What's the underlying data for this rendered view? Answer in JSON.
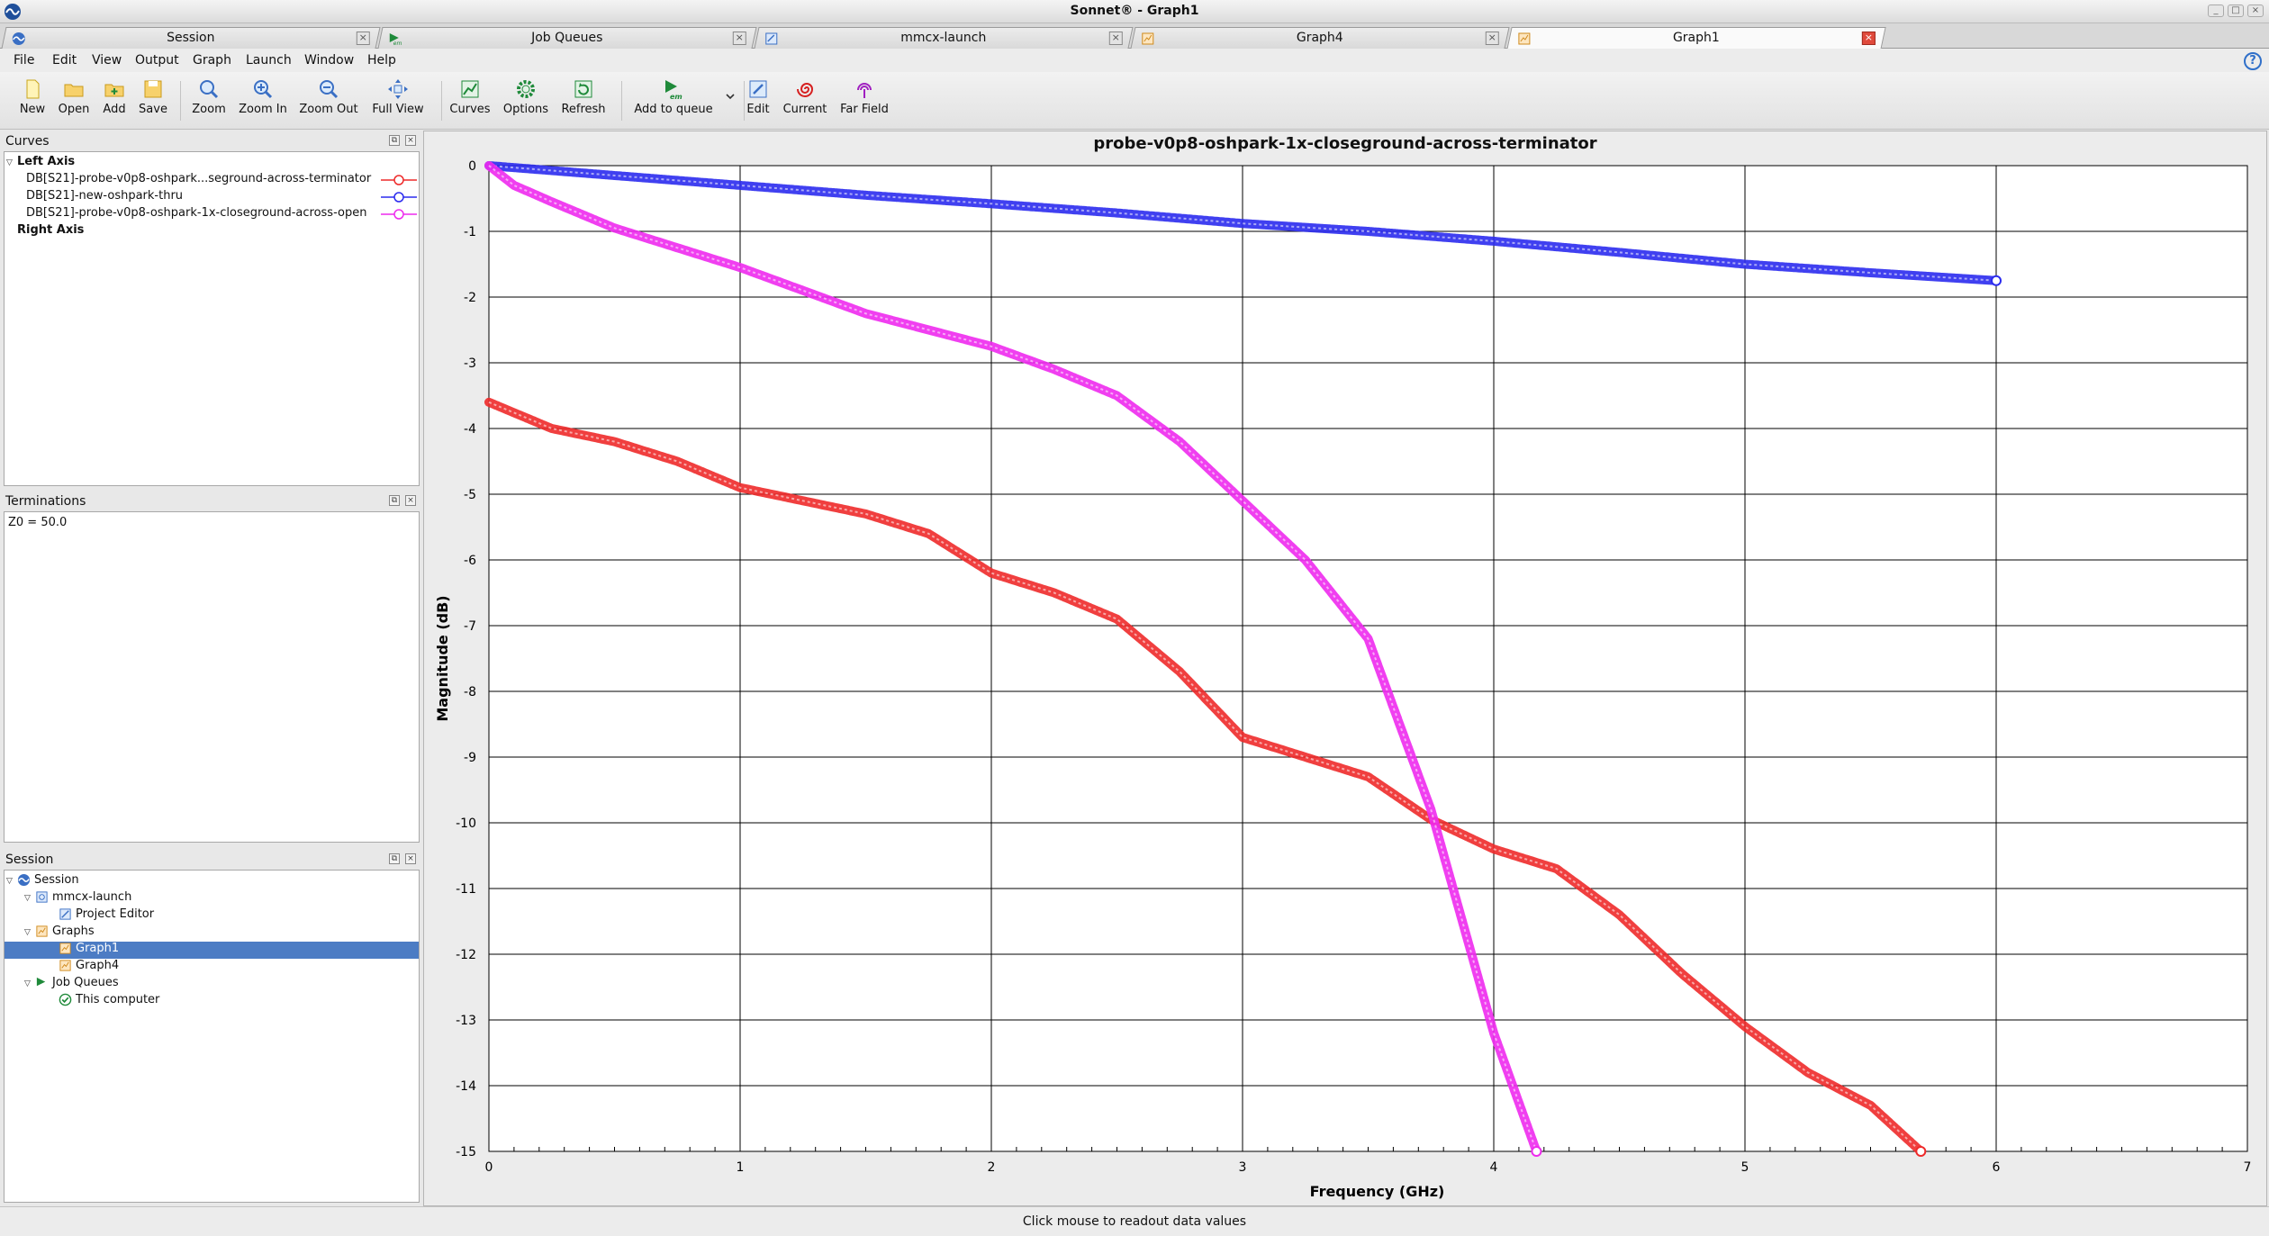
{
  "window": {
    "title": "Sonnet® - Graph1"
  },
  "tabs": [
    {
      "label": "Session",
      "icon": "session-icon",
      "active": false
    },
    {
      "label": "Job Queues",
      "icon": "job-queue-icon",
      "active": false
    },
    {
      "label": "mmcx-launch",
      "icon": "project-icon",
      "active": false
    },
    {
      "label": "Graph4",
      "icon": "graph-icon",
      "active": false
    },
    {
      "label": "Graph1",
      "icon": "graph-icon",
      "active": true
    }
  ],
  "menu": [
    "File",
    "Edit",
    "View",
    "Output",
    "Graph",
    "Launch",
    "Window",
    "Help"
  ],
  "toolbar": [
    {
      "label": "New",
      "icon": "new-file-icon"
    },
    {
      "label": "Open",
      "icon": "open-folder-icon"
    },
    {
      "label": "Add",
      "icon": "add-folder-icon"
    },
    {
      "label": "Save",
      "icon": "save-icon"
    },
    {
      "label": "Zoom",
      "icon": "zoom-icon"
    },
    {
      "label": "Zoom In",
      "icon": "zoom-in-icon"
    },
    {
      "label": "Zoom Out",
      "icon": "zoom-out-icon"
    },
    {
      "label": "Full View",
      "icon": "full-view-icon"
    },
    {
      "label": "Curves",
      "icon": "curves-icon"
    },
    {
      "label": "Options",
      "icon": "options-icon"
    },
    {
      "label": "Refresh",
      "icon": "refresh-icon"
    },
    {
      "label": "Add to queue",
      "icon": "add-to-queue-icon"
    },
    {
      "label": "Edit",
      "icon": "edit-icon"
    },
    {
      "label": "Current",
      "icon": "current-icon"
    },
    {
      "label": "Far Field",
      "icon": "far-field-icon"
    }
  ],
  "curves_panel": {
    "title": "Curves",
    "left_axis_label": "Left Axis",
    "right_axis_label": "Right Axis",
    "items": [
      {
        "label": "DB[S21]-probe-v0p8-oshpark...seground-across-terminator",
        "color": "#ee2a2a"
      },
      {
        "label": "DB[S21]-new-oshpark-thru",
        "color": "#2b2bee"
      },
      {
        "label": "DB[S21]-probe-v0p8-oshpark-1x-closeground-across-open",
        "color": "#ee2aee"
      }
    ]
  },
  "terminations_panel": {
    "title": "Terminations",
    "text": "Z0 = 50.0"
  },
  "session_panel": {
    "title": "Session",
    "tree": [
      {
        "label": "Session",
        "icon": "session-icon",
        "expanded": true
      },
      {
        "label": "mmcx-launch",
        "icon": "project-icon",
        "expanded": true
      },
      {
        "label": "Project Editor",
        "icon": "project-editor-icon"
      },
      {
        "label": "Graphs",
        "icon": "graphs-folder-icon",
        "expanded": true
      },
      {
        "label": "Graph1",
        "icon": "graph-icon",
        "selected": true
      },
      {
        "label": "Graph4",
        "icon": "graph-icon"
      },
      {
        "label": "Job Queues",
        "icon": "job-queue-icon",
        "expanded": true
      },
      {
        "label": "This computer",
        "icon": "check-icon"
      }
    ]
  },
  "status": {
    "text": "Click mouse to readout data values"
  },
  "chart_data": {
    "type": "line",
    "title": "probe-v0p8-oshpark-1x-closeground-across-terminator",
    "xlabel": "Frequency (GHz)",
    "ylabel": "Magnitude (dB)",
    "xlim": [
      0,
      7
    ],
    "ylim": [
      -15,
      0
    ],
    "xticks": [
      0,
      1,
      2,
      3,
      4,
      5,
      6,
      7
    ],
    "yticks": [
      0,
      -1,
      -2,
      -3,
      -4,
      -5,
      -6,
      -7,
      -8,
      -9,
      -10,
      -11,
      -12,
      -13,
      -14,
      -15
    ],
    "grid": true,
    "series": [
      {
        "name": "DB[S21]-probe-v0p8-oshpark...seground-across-terminator",
        "color": "#ee2a2a",
        "x": [
          0,
          0.25,
          0.5,
          0.75,
          1.0,
          1.25,
          1.5,
          1.75,
          2.0,
          2.25,
          2.5,
          2.75,
          3.0,
          3.25,
          3.5,
          3.75,
          4.0,
          4.25,
          4.5,
          4.75,
          5.0,
          5.25,
          5.5,
          5.7
        ],
        "y": [
          -3.6,
          -4.0,
          -4.2,
          -4.5,
          -4.9,
          -5.1,
          -5.3,
          -5.6,
          -6.2,
          -6.5,
          -6.9,
          -7.7,
          -8.7,
          -9.0,
          -9.3,
          -9.95,
          -10.4,
          -10.7,
          -11.4,
          -12.3,
          -13.1,
          -13.8,
          -14.3,
          -15.0
        ]
      },
      {
        "name": "DB[S21]-new-oshpark-thru",
        "color": "#2b2bee",
        "x": [
          0,
          0.5,
          1.0,
          1.5,
          2.0,
          2.5,
          3.0,
          3.5,
          4.0,
          4.5,
          5.0,
          5.5,
          6.0
        ],
        "y": [
          0,
          -0.15,
          -0.3,
          -0.45,
          -0.58,
          -0.72,
          -0.88,
          -1.0,
          -1.15,
          -1.32,
          -1.5,
          -1.63,
          -1.75
        ]
      },
      {
        "name": "DB[S21]-probe-v0p8-oshpark-1x-closeground-across-open",
        "color": "#ee2aee",
        "x": [
          0,
          0.1,
          0.25,
          0.5,
          0.75,
          1.0,
          1.25,
          1.5,
          1.75,
          2.0,
          2.25,
          2.5,
          2.75,
          3.0,
          3.25,
          3.5,
          3.75,
          4.0,
          4.17
        ],
        "y": [
          0,
          -0.3,
          -0.55,
          -0.95,
          -1.25,
          -1.55,
          -1.9,
          -2.25,
          -2.5,
          -2.75,
          -3.1,
          -3.5,
          -4.2,
          -5.1,
          -6.0,
          -7.2,
          -9.8,
          -13.2,
          -15.0
        ]
      }
    ]
  }
}
